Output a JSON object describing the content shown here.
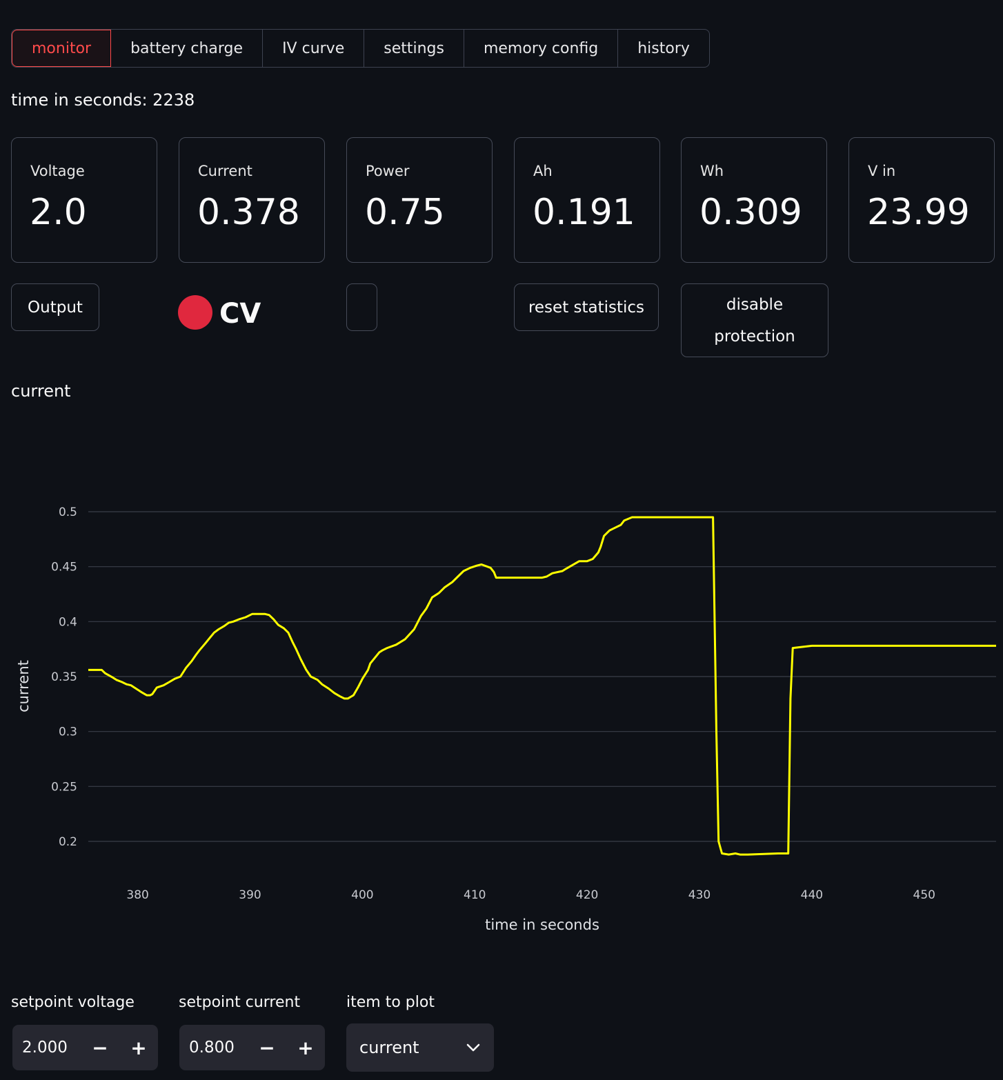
{
  "tabs": [
    "monitor",
    "battery charge",
    "IV curve",
    "settings",
    "memory config",
    "history"
  ],
  "time_text": "time in seconds: 2238",
  "metrics": [
    {
      "label": "Voltage",
      "value": "2.0"
    },
    {
      "label": "Current",
      "value": "0.378"
    },
    {
      "label": "Power",
      "value": "0.75"
    },
    {
      "label": "Ah",
      "value": "0.191"
    },
    {
      "label": "Wh",
      "value": "0.309"
    },
    {
      "label": "V in",
      "value": "23.99"
    }
  ],
  "controls": {
    "output_label": "Output",
    "mode": "CV",
    "mode_color": "#e0283e",
    "reset_label": "reset statistics",
    "disable_label_1": "disable",
    "disable_label_2": "protection"
  },
  "chart_title": "current",
  "chart_data": {
    "type": "line",
    "xlabel": "time in seconds",
    "ylabel": "current",
    "xlim": [
      375.6,
      456.4
    ],
    "ylim": [
      0.178,
      0.5
    ],
    "xticks": [
      380,
      390,
      400,
      410,
      420,
      430,
      440,
      450
    ],
    "yticks": [
      0.2,
      0.25,
      0.3,
      0.35,
      0.4,
      0.45,
      0.5
    ],
    "grid": true,
    "line_color": "#ffff00",
    "series": [
      {
        "x": [
          375.6,
          376.8,
          377.1,
          377.8,
          378.1,
          378.6,
          379.0,
          379.4,
          380.3,
          380.8,
          381.1,
          381.3,
          381.7,
          382.3,
          382.8,
          383.3,
          383.8,
          384.3,
          384.8,
          385.2,
          385.5,
          386.0,
          386.4,
          386.8,
          387.2,
          387.7,
          388.1,
          388.5,
          389.0,
          389.6,
          390.0,
          390.2,
          391.3,
          391.7,
          392.1,
          392.5,
          393.0,
          393.4,
          393.8,
          394.1,
          394.5,
          395.0,
          395.4,
          396.0,
          396.4,
          397.0,
          397.5,
          398.0,
          398.4,
          398.7,
          399.2,
          399.6,
          400.0,
          400.5,
          400.7,
          401.5,
          401.8,
          402.2,
          403.0,
          403.8,
          404.6,
          405.2,
          405.7,
          406.2,
          406.8,
          407.3,
          408.0,
          408.5,
          409.0,
          409.6,
          410.2,
          410.6,
          411.4,
          411.7,
          411.9,
          413.0,
          416.0,
          416.4,
          416.9,
          417.8,
          418.1,
          419.3,
          420.0,
          420.5,
          421.0,
          421.2,
          421.5,
          422.0,
          423.0,
          423.3,
          424.0,
          426.0,
          429.0,
          431.2,
          431.5,
          431.7,
          432.0,
          432.6,
          433.2,
          433.6,
          434.3,
          437.0,
          437.9,
          438.1,
          438.3,
          440.0,
          447.0,
          456.4
        ],
        "y": [
          0.356,
          0.356,
          0.353,
          0.349,
          0.347,
          0.345,
          0.343,
          0.342,
          0.336,
          0.333,
          0.333,
          0.334,
          0.34,
          0.342,
          0.345,
          0.348,
          0.35,
          0.358,
          0.364,
          0.37,
          0.374,
          0.38,
          0.385,
          0.39,
          0.393,
          0.396,
          0.399,
          0.4,
          0.402,
          0.404,
          0.406,
          0.407,
          0.407,
          0.406,
          0.402,
          0.397,
          0.394,
          0.39,
          0.381,
          0.375,
          0.366,
          0.356,
          0.35,
          0.347,
          0.343,
          0.339,
          0.335,
          0.332,
          0.33,
          0.33,
          0.333,
          0.34,
          0.348,
          0.356,
          0.362,
          0.372,
          0.374,
          0.376,
          0.379,
          0.384,
          0.393,
          0.405,
          0.412,
          0.422,
          0.426,
          0.431,
          0.436,
          0.441,
          0.446,
          0.449,
          0.451,
          0.452,
          0.449,
          0.445,
          0.44,
          0.44,
          0.44,
          0.441,
          0.444,
          0.446,
          0.448,
          0.455,
          0.455,
          0.457,
          0.463,
          0.468,
          0.478,
          0.483,
          0.488,
          0.492,
          0.495,
          0.495,
          0.495,
          0.495,
          0.3,
          0.2,
          0.189,
          0.188,
          0.189,
          0.188,
          0.188,
          0.189,
          0.189,
          0.33,
          0.376,
          0.378,
          0.378,
          0.378
        ]
      }
    ]
  },
  "inputs": {
    "setpoint_voltage_label": "setpoint voltage",
    "setpoint_voltage_value": "2.000",
    "setpoint_current_label": "setpoint current",
    "setpoint_current_value": "0.800",
    "item_to_plot_label": "item to plot",
    "item_to_plot_value": "current",
    "minus": "−",
    "plus": "+"
  }
}
